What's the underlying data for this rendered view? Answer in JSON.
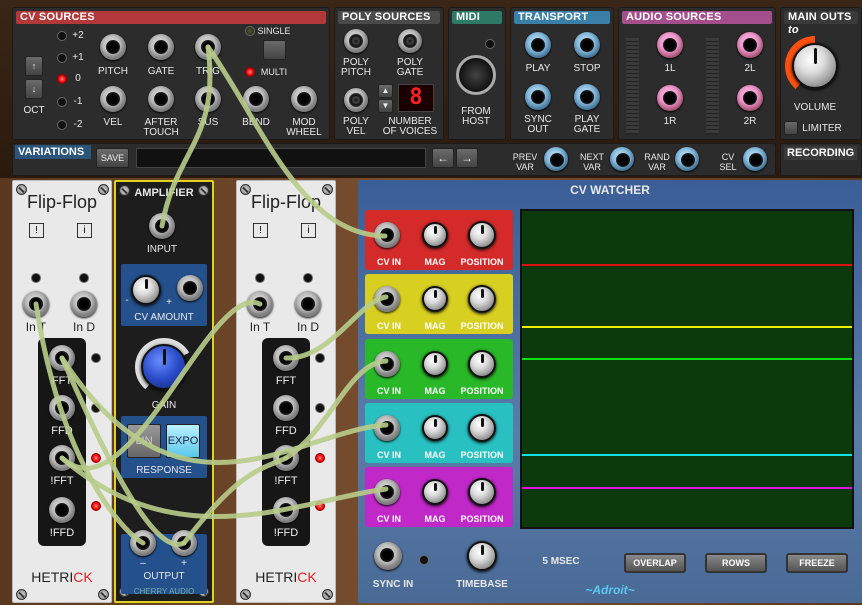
{
  "top": {
    "cv_sources": {
      "title": "CV SOURCES",
      "oct_label": "OCT",
      "oct_values": [
        "+2",
        "+1",
        "0",
        "-1",
        "-2"
      ],
      "jacks_row1": [
        "PITCH",
        "GATE",
        "TRIG"
      ],
      "jacks_row2": [
        "VEL",
        "AFTER\nTOUCH",
        "SUS",
        "BEND",
        "MOD\nWHEEL"
      ],
      "mode_single": "SINGLE",
      "mode_multi": "MULTI"
    },
    "poly_sources": {
      "title": "POLY SOURCES",
      "jacks": [
        "POLY\nPITCH",
        "POLY\nGATE",
        "POLY\nVEL"
      ],
      "voices_label": "NUMBER\nOF VOICES",
      "voices_value": "8"
    },
    "midi": {
      "title": "MIDI",
      "from_host": "FROM\nHOST"
    },
    "transport": {
      "title": "TRANSPORT",
      "jacks": [
        "PLAY",
        "STOP",
        "SYNC\nOUT",
        "PLAY\nGATE"
      ]
    },
    "audio_sources": {
      "title": "AUDIO SOURCES",
      "jacks": [
        "1L",
        "2L",
        "1R",
        "2R"
      ]
    },
    "main_outs": {
      "title": "MAIN OUTS",
      "title_extra": "to",
      "volume": "VOLUME",
      "limiter": "LIMITER"
    },
    "variations": {
      "title": "VARIATIONS",
      "save": "SAVE",
      "jacks": [
        "PREV\nVAR",
        "NEXT\nVAR",
        "RAND\nVAR",
        "CV\nSEL"
      ]
    },
    "recording": {
      "title": "RECORDING"
    }
  },
  "flipflop1": {
    "title": "Flip-Flop",
    "icons": [
      "!",
      "i"
    ],
    "in_t": "In T",
    "in_d": "In D",
    "outs": [
      "FFT",
      "FFD",
      "!FFT",
      "!FFD"
    ],
    "brand_a": "HETRI",
    "brand_b": "CK"
  },
  "flipflop2": {
    "title": "Flip-Flop",
    "icons": [
      "!",
      "i"
    ],
    "in_t": "In T",
    "in_d": "In D",
    "outs": [
      "FFT",
      "FFD",
      "!FFT",
      "!FFD"
    ],
    "brand_a": "HETRI",
    "brand_b": "CK"
  },
  "amplifier": {
    "title": "AMPLIFIER",
    "input": "INPUT",
    "cv_amount": "CV AMOUNT",
    "minus": "-",
    "plus": "+",
    "gain": "GAIN",
    "lin": "LIN",
    "expo": "EXPO",
    "response": "RESPONSE",
    "out_minus": "–",
    "out_plus": "+",
    "output": "OUTPUT",
    "brand": "CHERRY AUDIO"
  },
  "cv_watcher": {
    "title": "CV WATCHER",
    "rows": [
      {
        "color": "#d42a2a",
        "trace": "#e01010",
        "cv_in": "CV IN",
        "mag": "MAG",
        "position": "POSITION"
      },
      {
        "color": "#d8d020",
        "trace": "#f0f000",
        "cv_in": "CV IN",
        "mag": "MAG",
        "position": "POSITION"
      },
      {
        "color": "#28b828",
        "trace": "#10e010",
        "cv_in": "CV IN",
        "mag": "MAG",
        "position": "POSITION"
      },
      {
        "color": "#28c0c0",
        "trace": "#10e0e0",
        "cv_in": "CV IN",
        "mag": "MAG",
        "position": "POSITION"
      },
      {
        "color": "#c028c8",
        "trace": "#e010e0",
        "cv_in": "CV IN",
        "mag": "MAG",
        "position": "POSITION"
      }
    ],
    "sync_in": "SYNC IN",
    "timebase": "TIMEBASE",
    "msec": "5 MSEC",
    "overlap": "OVERLAP",
    "rows_btn": "ROWS",
    "freeze": "FREEZE",
    "brand": "~Adroit~"
  }
}
